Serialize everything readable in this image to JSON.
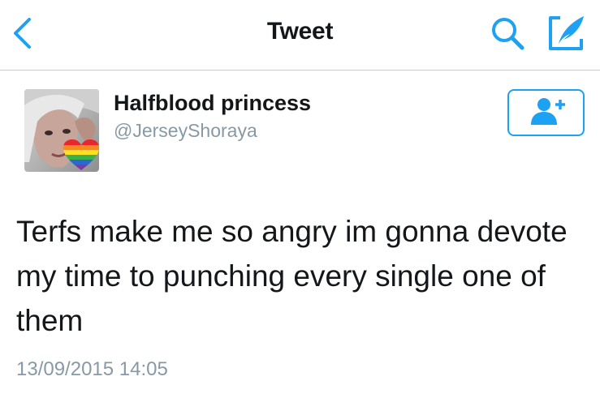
{
  "nav": {
    "title": "Tweet"
  },
  "icons": {
    "back": "chevron-left-icon",
    "search": "search-icon",
    "compose": "compose-icon",
    "follow": "add-user-icon"
  },
  "user": {
    "display_name": "Halfblood princess",
    "screen_name": "@JerseyShoraya"
  },
  "tweet": {
    "text": "Terfs make me so angry im gonna devote my time to punching every single one of them",
    "timestamp": "13/09/2015 14:05"
  },
  "colors": {
    "accent": "#1da1f2",
    "text_primary": "#14171a",
    "text_secondary": "#8899a6",
    "divider": "#c8c8cc"
  }
}
